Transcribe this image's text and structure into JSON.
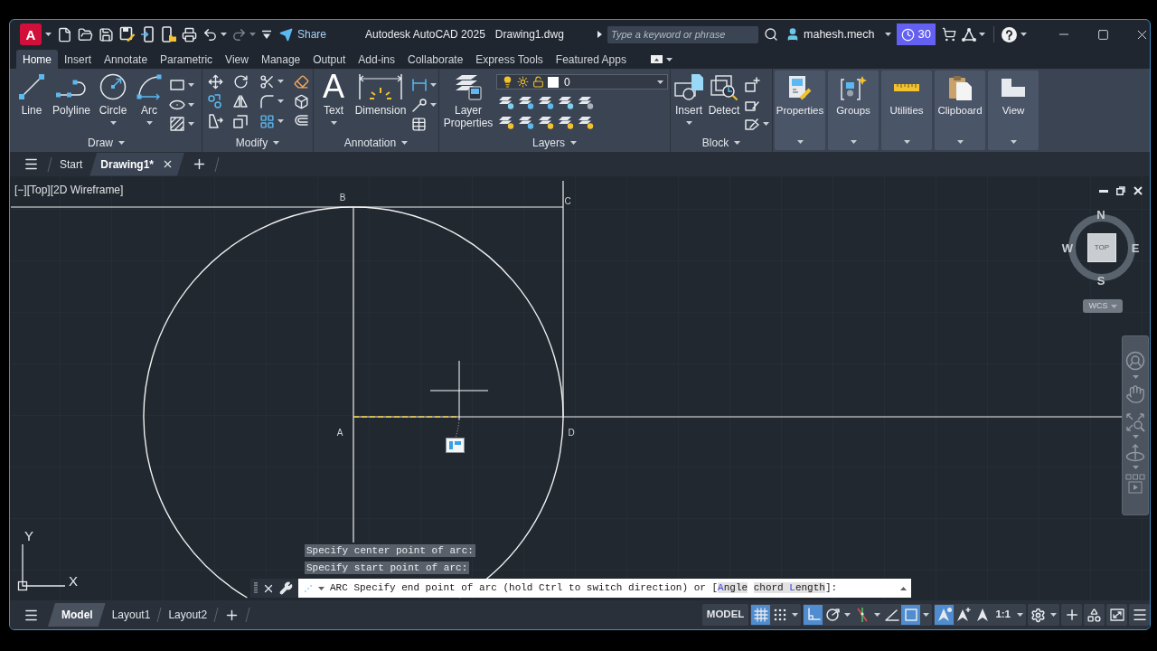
{
  "title_bar": {
    "app_letter": "A",
    "redo": {
      "disabled": true
    },
    "share": "Share",
    "product": "Autodesk AutoCAD 2025",
    "document": "Drawing1.dwg",
    "search": {
      "placeholder": "Type a keyword or phrase"
    },
    "user": "mahesh.mech",
    "trial_days": "30"
  },
  "ribbon": {
    "tabs": [
      {
        "label": "Home",
        "selected": true
      },
      {
        "label": "Insert",
        "selected": false
      },
      {
        "label": "Annotate",
        "selected": false
      },
      {
        "label": "Parametric",
        "selected": false
      },
      {
        "label": "View",
        "selected": false
      },
      {
        "label": "Manage",
        "selected": false
      },
      {
        "label": "Output",
        "selected": false
      },
      {
        "label": "Add-ins",
        "selected": false
      },
      {
        "label": "Collaborate",
        "selected": false
      },
      {
        "label": "Express Tools",
        "selected": false
      },
      {
        "label": "Featured Apps",
        "selected": false
      }
    ],
    "panels": [
      {
        "kind": "draw",
        "title": "Draw",
        "tools": [
          {
            "label": "Line",
            "dropdown": false
          },
          {
            "label": "Polyline",
            "dropdown": false
          },
          {
            "label": "Circle",
            "dropdown": true
          },
          {
            "label": "Arc",
            "dropdown": true
          }
        ]
      },
      {
        "kind": "modify",
        "title": "Modify"
      },
      {
        "kind": "annotation",
        "title": "Annotation",
        "tools": [
          {
            "label": "Text",
            "glyph": "A",
            "dropdown": true
          },
          {
            "label": "Dimension",
            "dropdown": false
          }
        ]
      },
      {
        "kind": "layers",
        "title": "Layers",
        "tools": [
          {
            "label": "Layer Properties",
            "dropdown": false
          }
        ],
        "current_layer": "0"
      },
      {
        "kind": "block",
        "title": "Block",
        "tools": [
          {
            "label": "Insert",
            "dropdown": true
          },
          {
            "label": "Detect",
            "dropdown": false
          }
        ]
      }
    ],
    "collapsed_panels": [
      {
        "label": "Properties"
      },
      {
        "label": "Groups"
      },
      {
        "label": "Utilities"
      },
      {
        "label": "Clipboard"
      },
      {
        "label": "View"
      }
    ]
  },
  "file_tabs": [
    {
      "label": "Start",
      "selected": false,
      "closable": false
    },
    {
      "label": "Drawing1*",
      "selected": true,
      "closable": true
    }
  ],
  "viewport": {
    "controls": [
      "[−]",
      "[Top]",
      "[2D Wireframe]"
    ],
    "point_labels": [
      "B",
      "C",
      "A",
      "D"
    ],
    "view_cube": {
      "north": "N",
      "west": "W",
      "east": "E",
      "south": "S",
      "face": "TOP",
      "ucs": "WCS"
    },
    "ucs_axes": {
      "y": "Y",
      "x": "X"
    }
  },
  "command_line": {
    "history": [
      "Specify center point of arc:",
      "Specify start point of arc:"
    ],
    "command": "ARC",
    "prompt": "Specify end point of arc (hold Ctrl to switch direction) or [",
    "options": [
      {
        "key": "A",
        "after": "ngle"
      },
      {
        "before": "chord ",
        "key": "L",
        "after": "ength"
      }
    ],
    "prompt_end": "]:"
  },
  "layout_tabs": [
    {
      "label": "Model",
      "selected": true
    },
    {
      "label": "Layout1",
      "selected": false
    },
    {
      "label": "Layout2",
      "selected": false
    }
  ],
  "status_bar": {
    "groups": [
      {
        "items": [
          {
            "kind": "label",
            "text": "MODEL",
            "on": false
          }
        ]
      },
      {
        "items": [
          {
            "kind": "grid",
            "on": true
          },
          {
            "kind": "snap",
            "on": false
          },
          {
            "kind": "caret",
            "on": false
          }
        ]
      },
      {
        "items": [
          {
            "kind": "ortho",
            "on": true
          },
          {
            "kind": "polar",
            "on": false
          },
          {
            "kind": "caret",
            "on": false
          },
          {
            "kind": "tracking",
            "on": false
          },
          {
            "kind": "caret",
            "on": false
          },
          {
            "kind": "isodraft",
            "on": false
          },
          {
            "kind": "osnap",
            "on": true
          },
          {
            "kind": "caret",
            "on": false
          }
        ]
      },
      {
        "items": [
          {
            "kind": "annotation",
            "on": true
          },
          {
            "kind": "autoscale",
            "on": false
          },
          {
            "kind": "scale",
            "on": false
          },
          {
            "kind": "label",
            "text": "1:1",
            "on": false
          },
          {
            "kind": "caret",
            "on": false
          }
        ]
      },
      {
        "items": [
          {
            "kind": "gear",
            "on": false
          },
          {
            "kind": "caret",
            "on": false
          }
        ]
      },
      {
        "items": [
          {
            "kind": "plus",
            "on": false
          }
        ]
      },
      {
        "items": [
          {
            "kind": "isolate",
            "on": false
          }
        ]
      },
      {
        "items": [
          {
            "kind": "fullscreen",
            "on": false
          }
        ]
      },
      {
        "items": [
          {
            "kind": "menu",
            "on": false
          }
        ]
      }
    ]
  }
}
